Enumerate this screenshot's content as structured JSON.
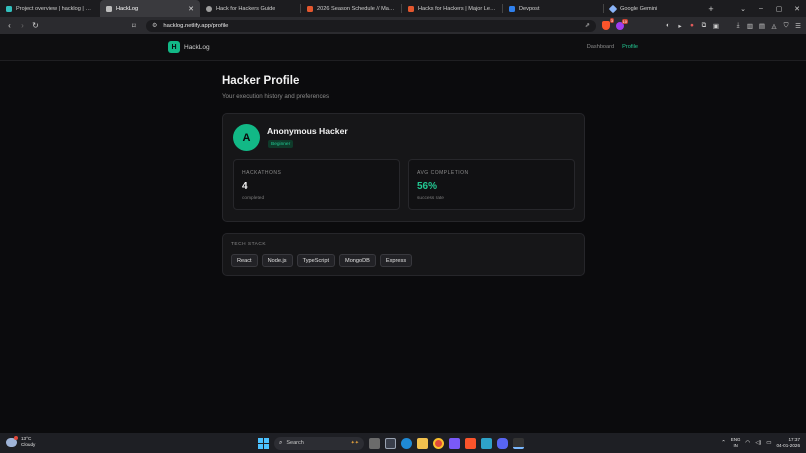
{
  "browser": {
    "tabs": [
      {
        "title": "Project overview | hacklog | Netlify",
        "favicon_color": "#32bfbd",
        "active": false
      },
      {
        "title": "HackLog",
        "favicon_color": "#bdbdbd",
        "active": true
      },
      {
        "title": "Hack for Hackers Guide",
        "favicon_color": "#9e9e9e",
        "active": false
      },
      {
        "title": "2026 Season Schedule // Major Leag",
        "favicon_color": "#e4572e",
        "active": false
      },
      {
        "title": "Hacks for Hackers | Major League Ha",
        "favicon_color": "#e4572e",
        "active": false
      },
      {
        "title": "Devpost",
        "favicon_color": "#2f80ed",
        "active": false
      },
      {
        "title": "Google Gemini",
        "favicon_color": "#8ab4f8",
        "active": false
      }
    ],
    "new_tab_glyph": "+",
    "window_controls": [
      "⌄",
      "–",
      "▢",
      "✕"
    ],
    "url": "hacklog.netlify.app/profile",
    "shield_count": "3",
    "rewards_count": "10"
  },
  "app": {
    "logo_letter": "H",
    "brand": "HackLog",
    "nav": [
      {
        "label": "Dashboard",
        "active": false
      },
      {
        "label": "Profile",
        "active": true
      }
    ],
    "accent_color": "#22c993"
  },
  "profile": {
    "title": "Hacker Profile",
    "subtitle": "Your execution history and preferences",
    "avatar_letter": "A",
    "name": "Anonymous Hacker",
    "level": "Beginner",
    "stats": [
      {
        "label": "HACKATHONS",
        "value": "4",
        "caption": "completed"
      },
      {
        "label": "AVG COMPLETION",
        "value": "56%",
        "caption": "success rate"
      }
    ],
    "tech_stack_label": "TECH STACK",
    "tech_stack": [
      "React",
      "Node.js",
      "TypeScript",
      "MongoDB",
      "Express"
    ]
  },
  "taskbar": {
    "weather_temp": "13°C",
    "weather_desc": "Cloudy",
    "search_placeholder": "Search",
    "language": "ENG",
    "language_region": "IN",
    "time": "17:37",
    "date": "04-01-2026"
  }
}
